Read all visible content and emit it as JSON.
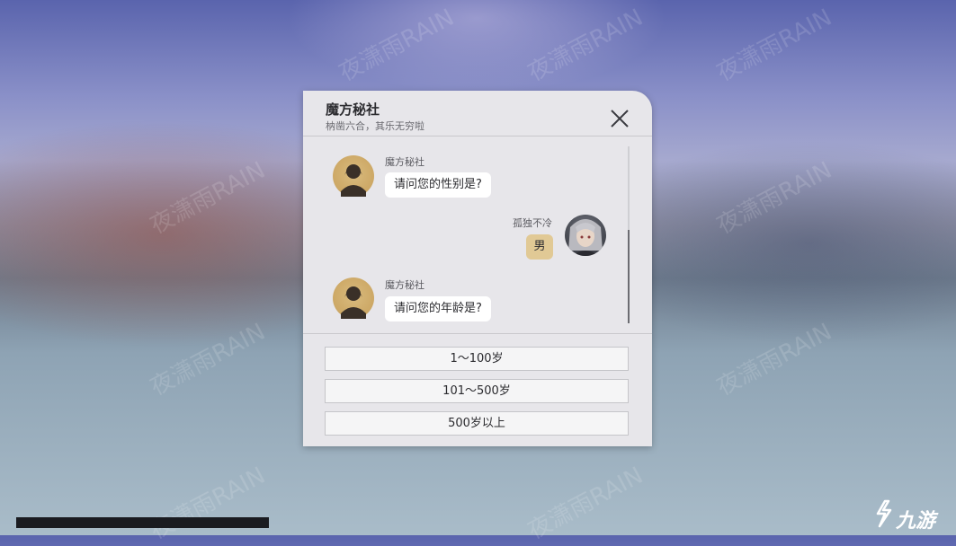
{
  "background": {
    "watermark_text": "夜潇雨RAIN"
  },
  "dialog": {
    "title": "魔方秘社",
    "subtitle": "枘凿六合，其乐无穷啦",
    "close_icon": "close-x-icon"
  },
  "messages": [
    {
      "side": "left",
      "sender": "魔方秘社",
      "text": "请问您的性别是?",
      "avatar": "silhouette-avatar"
    },
    {
      "side": "right",
      "sender": "孤独不冷",
      "text": "男",
      "avatar": "gray-haired-character-avatar"
    },
    {
      "side": "left",
      "sender": "魔方秘社",
      "text": "请问您的年龄是?",
      "avatar": "silhouette-avatar"
    }
  ],
  "options": [
    {
      "label": "1～100岁"
    },
    {
      "label": "101～500岁"
    },
    {
      "label": "500岁以上"
    }
  ],
  "branding": {
    "logo_text": "九游"
  },
  "colors": {
    "panel_bg": "#e7e6ea",
    "player_bubble": "#e1c995",
    "npc_bubble": "#ffffff"
  }
}
